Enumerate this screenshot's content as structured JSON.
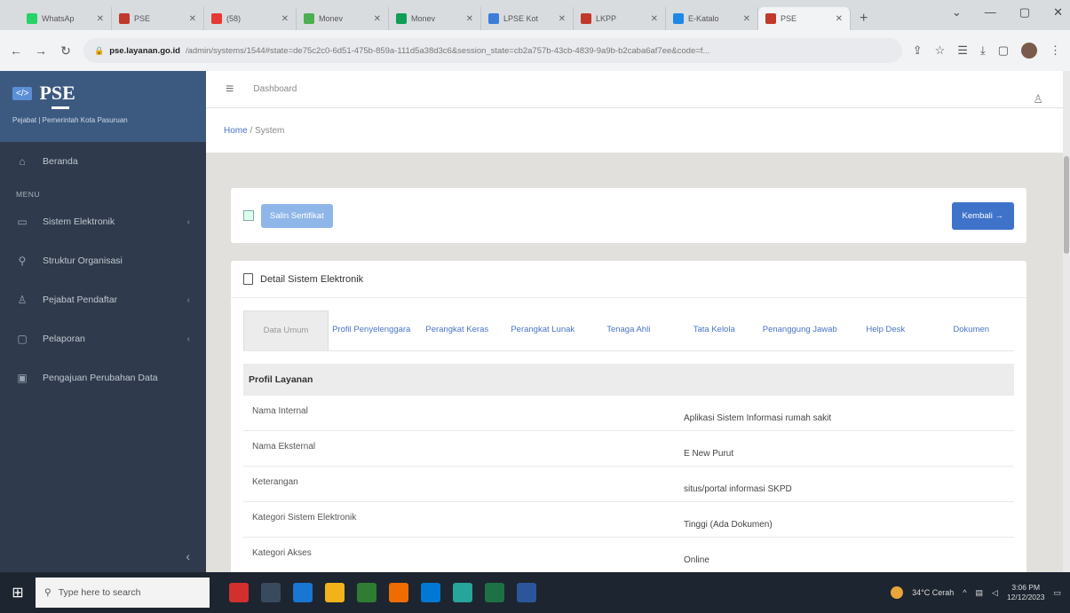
{
  "browser": {
    "tabs": [
      {
        "title": "WhatsAp",
        "color": "#25d366",
        "active": false
      },
      {
        "title": "PSE",
        "color": "#c0392b",
        "active": false
      },
      {
        "title": "(58)",
        "color": "#e53935",
        "active": false
      },
      {
        "title": "Monev",
        "color": "#4caf50",
        "active": false
      },
      {
        "title": "Monev",
        "color": "#0f9d58",
        "active": false
      },
      {
        "title": "LPSE Kot",
        "color": "#3b7dd8",
        "active": false
      },
      {
        "title": "LKPP",
        "color": "#c0392b",
        "active": false
      },
      {
        "title": "E-Katalo",
        "color": "#1e88e5",
        "active": false
      },
      {
        "title": "PSE",
        "color": "#c0392b",
        "active": true
      }
    ],
    "url_host": "pse.layanan.go.id",
    "url_path": "/admin/systems/1544#state=de75c2c0-6d51-475b-859a-111d5a38d3c6&session_state=cb2a757b-43cb-4839-9a9b-b2caba6af7ee&code=f..."
  },
  "sidebar": {
    "logo_text": "</>",
    "brand": "PSE",
    "subtitle": "Pejabat | Pemerintah Kota Pasuruan",
    "menu_label": "MENU",
    "items": [
      {
        "label": "Beranda",
        "icon": "home-icon",
        "glyph": "⌂",
        "chevron": false
      },
      {
        "label": "Sistem Elektronik",
        "icon": "system-icon",
        "glyph": "▭",
        "chevron": true
      },
      {
        "label": "Struktur Organisasi",
        "icon": "org-icon",
        "glyph": "⚲",
        "chevron": false
      },
      {
        "label": "Pejabat Pendaftar",
        "icon": "user-icon",
        "glyph": "♙",
        "chevron": true
      },
      {
        "label": "Pelaporan",
        "icon": "report-icon",
        "glyph": "▢",
        "chevron": true
      },
      {
        "label": "Pengajuan Perubahan Data",
        "icon": "edit-icon",
        "glyph": "▣",
        "chevron": false
      }
    ]
  },
  "topbar": {
    "title": "Dashboard"
  },
  "breadcrumb": {
    "home": "Home",
    "sep": "/",
    "current": "System"
  },
  "actions": {
    "cert_label": "Salin Sertifikat",
    "back_label": "Kembali →"
  },
  "detail": {
    "title": "Detail Sistem Elektronik",
    "tabs": [
      {
        "label": "Data Umum",
        "active": true
      },
      {
        "label": "Profil Penyelenggara",
        "active": false
      },
      {
        "label": "Perangkat Keras",
        "active": false
      },
      {
        "label": "Perangkat Lunak",
        "active": false
      },
      {
        "label": "Tenaga Ahli",
        "active": false
      },
      {
        "label": "Tata Kelola",
        "active": false
      },
      {
        "label": "Penanggung Jawab",
        "active": false
      },
      {
        "label": "Help Desk",
        "active": false
      },
      {
        "label": "Dokumen",
        "active": false
      }
    ],
    "section": "Profil Layanan",
    "rows": [
      {
        "key": "Nama Internal",
        "value": "Aplikasi Sistem Informasi rumah sakit"
      },
      {
        "key": "Nama Eksternal",
        "value": "E New Purut"
      },
      {
        "key": "Keterangan",
        "value": "situs/portal informasi SKPD"
      },
      {
        "key": "Kategori Sistem Elektronik",
        "value": "Tinggi (Ada Dokumen)"
      },
      {
        "key": "Kategori Akses",
        "value": "Online"
      }
    ]
  },
  "taskbar": {
    "search_placeholder": "Type here to search",
    "weather": "34°C Cerah",
    "time": "3:06 PM",
    "date": "12/12/2023",
    "apps": [
      "#d32f2f",
      "#3a4a5e",
      "#1976d2",
      "#f2b21b",
      "#2e7d32",
      "#ef6c00",
      "#0078d4",
      "#26a69a",
      "#1e7145",
      "#2b579a"
    ]
  }
}
